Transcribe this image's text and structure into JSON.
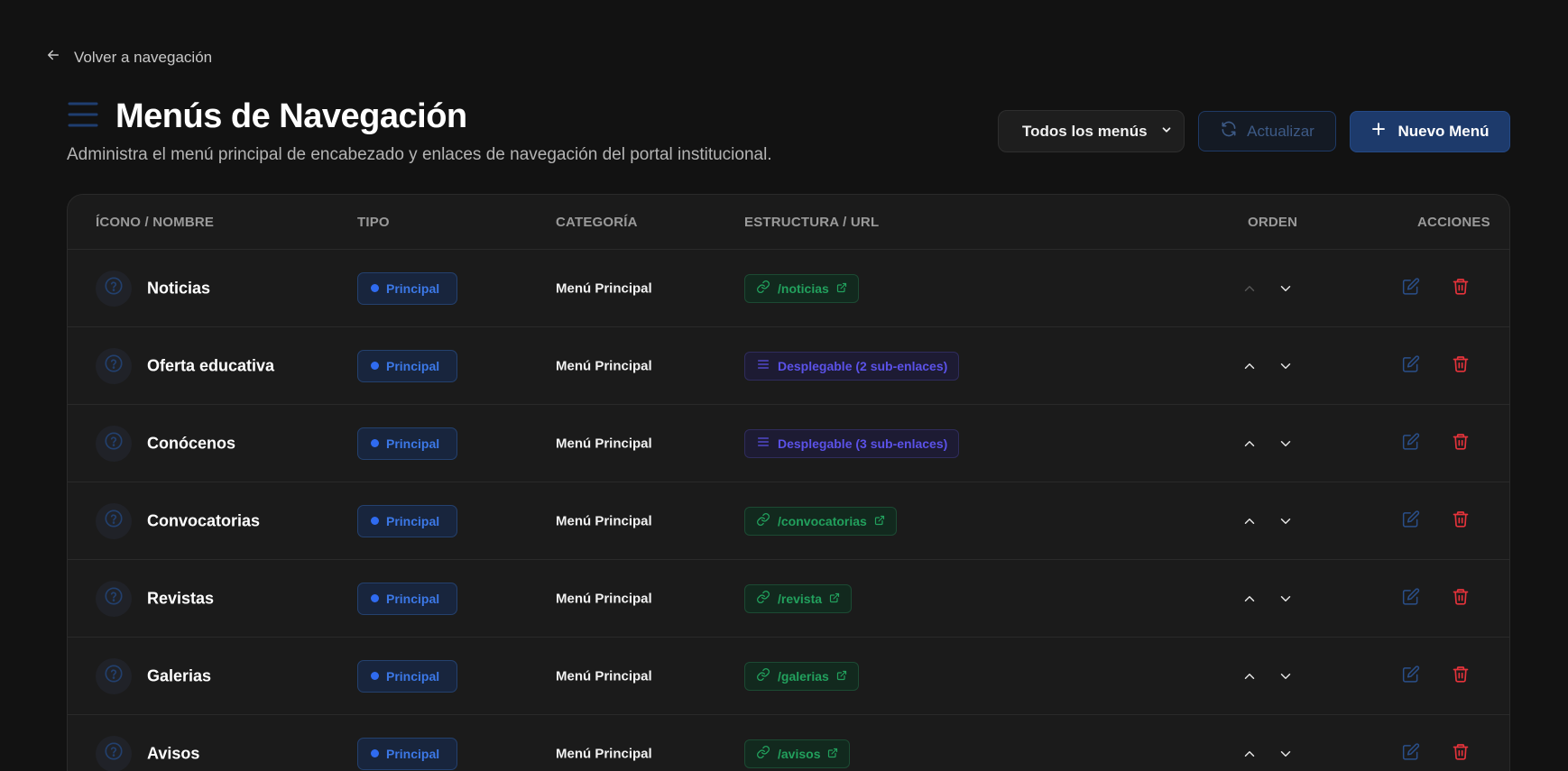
{
  "nav": {
    "back_label": "Volver a navegación"
  },
  "header": {
    "title": "Menús de Navegación",
    "subtitle": "Administra el menú principal de encabezado y enlaces de navegación del portal institucional."
  },
  "toolbar": {
    "filter_value": "Todos los menús",
    "refresh_label": "Actualizar",
    "new_label": "Nuevo Menú"
  },
  "table": {
    "columns": {
      "name": "ÍCONO / NOMBRE",
      "type": "TIPO",
      "category": "CATEGORÍA",
      "structure": "ESTRUCTURA / URL",
      "order": "ORDEN",
      "actions": "ACCIONES"
    },
    "rows": [
      {
        "name": "Noticias",
        "type": "Principal",
        "category": "Menú Principal",
        "kind": "link",
        "structure": "/noticias",
        "up_enabled": false
      },
      {
        "name": "Oferta educativa",
        "type": "Principal",
        "category": "Menú Principal",
        "kind": "dropdown",
        "structure": "Desplegable (2 sub-enlaces)",
        "up_enabled": true
      },
      {
        "name": "Conócenos",
        "type": "Principal",
        "category": "Menú Principal",
        "kind": "dropdown",
        "structure": "Desplegable (3 sub-enlaces)",
        "up_enabled": true
      },
      {
        "name": "Convocatorias",
        "type": "Principal",
        "category": "Menú Principal",
        "kind": "link",
        "structure": "/convocatorias",
        "up_enabled": true
      },
      {
        "name": "Revistas",
        "type": "Principal",
        "category": "Menú Principal",
        "kind": "link",
        "structure": "/revista",
        "up_enabled": true
      },
      {
        "name": "Galerias",
        "type": "Principal",
        "category": "Menú Principal",
        "kind": "link",
        "structure": "/galerias",
        "up_enabled": true
      },
      {
        "name": "Avisos",
        "type": "Principal",
        "category": "Menú Principal",
        "kind": "link",
        "structure": "/avisos",
        "up_enabled": true
      }
    ]
  },
  "colors": {
    "background": "#121212",
    "accent_blue": "#2f6bf0",
    "link_green": "#22a05d",
    "dropdown_purple": "#5b52e8",
    "delete_red": "#e5333b"
  }
}
